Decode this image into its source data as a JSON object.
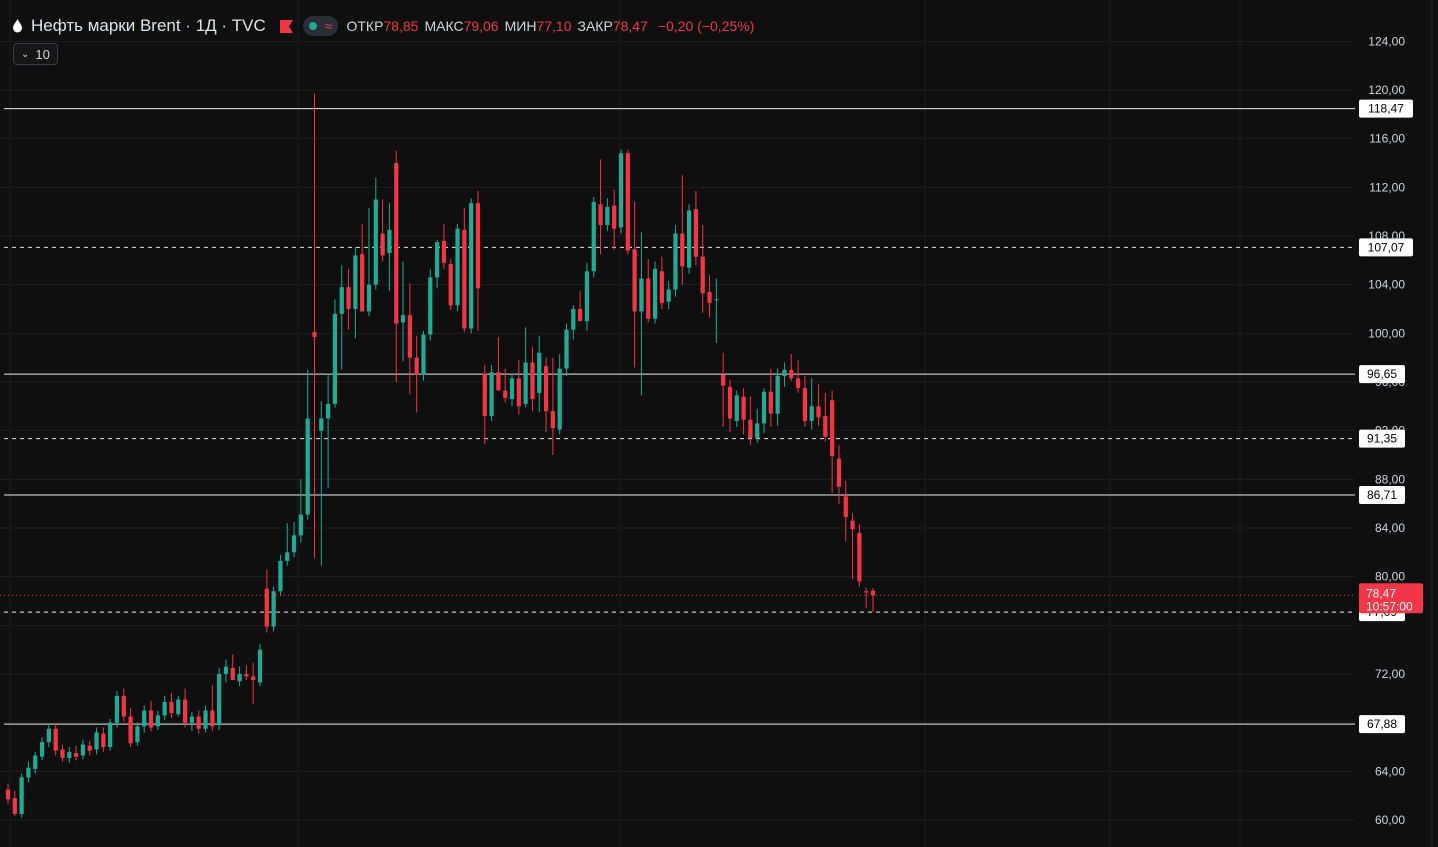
{
  "legend": {
    "title": "Нефть марки Brent · 1Д · TVC",
    "open_label": "ОТКР",
    "open": "78,85",
    "high_label": "МАКС",
    "high": "79,06",
    "low_label": "МИН",
    "low": "77,10",
    "close_label": "ЗАКР",
    "close": "78,47",
    "change": "−0,20 (−0,25%)",
    "collapse_count": "10"
  },
  "colors": {
    "up": "#22ab94",
    "down": "#f23645",
    "background": "#0f0f0f",
    "grid": "#1e1e1e"
  },
  "chart_data": {
    "type": "candlestick",
    "y_axis": {
      "ticks": [
        60,
        64,
        68,
        72,
        76,
        80,
        84,
        88,
        92,
        96,
        100,
        104,
        108,
        112,
        116,
        120,
        124
      ],
      "tick_labels": [
        "60,00",
        "64,00",
        "",
        "72,00",
        "",
        "80,00",
        "84,00",
        "88,00",
        "92,00",
        "96,00",
        "100,00",
        "104,00",
        "108,00",
        "112,00",
        "116,00",
        "120,00",
        "124,00"
      ],
      "ylim": [
        59,
        126
      ],
      "position": "right"
    },
    "current_price": {
      "value": 78.47,
      "label": "78,47",
      "countdown": "10:57:00"
    },
    "levels": [
      {
        "value": 118.47,
        "label": "118,47",
        "style": "solid"
      },
      {
        "value": 107.07,
        "label": "107,07",
        "style": "dashed"
      },
      {
        "value": 96.65,
        "label": "96,65",
        "style": "solid"
      },
      {
        "value": 91.35,
        "label": "91,35",
        "style": "dashed"
      },
      {
        "value": 86.71,
        "label": "86,71",
        "style": "solid"
      },
      {
        "value": 77.09,
        "label": "77,09",
        "style": "dashed"
      },
      {
        "value": 67.88,
        "label": "67,88",
        "style": "solid"
      }
    ],
    "candles": [
      [
        62.5,
        63.0,
        61.3,
        61.7
      ],
      [
        61.8,
        62.4,
        60.3,
        60.5
      ],
      [
        60.5,
        63.8,
        60.2,
        63.5
      ],
      [
        63.5,
        64.8,
        63.1,
        64.3
      ],
      [
        64.2,
        65.6,
        63.8,
        65.3
      ],
      [
        65.2,
        66.8,
        64.9,
        66.4
      ],
      [
        66.4,
        67.9,
        66.0,
        67.5
      ],
      [
        67.5,
        67.9,
        65.3,
        65.7
      ],
      [
        65.8,
        66.2,
        64.8,
        65.1
      ],
      [
        65.1,
        66.0,
        64.7,
        65.6
      ],
      [
        65.5,
        66.1,
        64.9,
        65.2
      ],
      [
        65.3,
        66.6,
        65.0,
        66.2
      ],
      [
        66.1,
        66.5,
        65.3,
        65.7
      ],
      [
        65.8,
        67.6,
        65.4,
        67.2
      ],
      [
        67.1,
        67.6,
        65.6,
        66.0
      ],
      [
        66.0,
        68.3,
        65.7,
        68.0
      ],
      [
        68.0,
        70.6,
        67.6,
        70.2
      ],
      [
        70.2,
        70.8,
        68.1,
        68.5
      ],
      [
        68.5,
        69.2,
        66.0,
        66.3
      ],
      [
        66.4,
        68.0,
        66.1,
        67.7
      ],
      [
        67.7,
        69.4,
        67.2,
        69.0
      ],
      [
        69.0,
        69.8,
        67.3,
        67.6
      ],
      [
        67.7,
        69.0,
        67.4,
        68.6
      ],
      [
        68.6,
        70.2,
        68.2,
        69.7
      ],
      [
        69.7,
        70.4,
        68.4,
        68.8
      ],
      [
        68.7,
        70.2,
        68.5,
        69.9
      ],
      [
        69.9,
        70.8,
        67.6,
        68.0
      ],
      [
        68.0,
        68.9,
        67.3,
        68.5
      ],
      [
        68.5,
        69.0,
        67.1,
        67.5
      ],
      [
        67.5,
        69.4,
        67.2,
        69.0
      ],
      [
        69.0,
        71.1,
        67.3,
        67.7
      ],
      [
        67.8,
        72.5,
        67.4,
        72.0
      ],
      [
        72.0,
        73.2,
        71.3,
        72.6
      ],
      [
        72.5,
        73.6,
        72.0,
        71.5
      ],
      [
        71.4,
        72.6,
        71.0,
        72.0
      ],
      [
        72.0,
        72.7,
        71.5,
        71.8
      ],
      [
        71.8,
        72.9,
        69.5,
        71.5
      ],
      [
        71.3,
        74.5,
        71.0,
        74.0
      ],
      [
        79.0,
        80.6,
        75.4,
        75.9
      ],
      [
        75.9,
        79.2,
        75.5,
        78.8
      ],
      [
        78.8,
        81.8,
        78.4,
        81.3
      ],
      [
        81.3,
        84.4,
        80.9,
        82.0
      ],
      [
        82.0,
        84.5,
        81.6,
        83.4
      ],
      [
        83.4,
        88.0,
        82.8,
        85.1
      ],
      [
        85.1,
        97.0,
        84.7,
        93.0
      ],
      [
        100.1,
        119.7,
        81.5,
        99.7
      ],
      [
        92.0,
        94.4,
        80.9,
        93.0
      ],
      [
        93.0,
        96.7,
        87.3,
        94.2
      ],
      [
        94.2,
        102.8,
        93.9,
        101.6
      ],
      [
        101.6,
        105.6,
        97.0,
        103.8
      ],
      [
        103.8,
        105.3,
        100.3,
        102.0
      ],
      [
        102.0,
        107.1,
        99.6,
        106.4
      ],
      [
        106.5,
        109.0,
        102.8,
        101.8
      ],
      [
        101.8,
        110.3,
        101.4,
        104.0
      ],
      [
        104.0,
        112.8,
        103.6,
        111.0
      ],
      [
        108.2,
        111.0,
        105.9,
        106.4
      ],
      [
        106.6,
        110.7,
        103.5,
        108.5
      ],
      [
        114.0,
        115.0,
        96.0,
        100.8
      ],
      [
        100.9,
        105.9,
        97.7,
        101.5
      ],
      [
        101.5,
        104.1,
        95.0,
        98.0
      ],
      [
        98.0,
        99.8,
        93.5,
        96.6
      ],
      [
        96.6,
        100.2,
        96.1,
        99.9
      ],
      [
        99.9,
        105.3,
        99.4,
        104.6
      ],
      [
        104.6,
        107.7,
        103.7,
        107.5
      ],
      [
        107.6,
        109.0,
        105.3,
        105.8
      ],
      [
        105.7,
        106.1,
        101.9,
        102.3
      ],
      [
        102.3,
        109.0,
        101.8,
        108.6
      ],
      [
        108.5,
        110.3,
        100.1,
        100.4
      ],
      [
        100.4,
        111.1,
        100.0,
        110.7
      ],
      [
        110.7,
        111.7,
        100.2,
        103.7
      ],
      [
        96.7,
        97.4,
        90.9,
        93.2
      ],
      [
        93.2,
        97.4,
        92.8,
        96.8
      ],
      [
        96.8,
        99.7,
        95.8,
        95.3
      ],
      [
        95.3,
        97.1,
        94.3,
        94.7
      ],
      [
        94.6,
        96.7,
        94.0,
        96.3
      ],
      [
        96.3,
        97.8,
        93.3,
        94.0
      ],
      [
        94.2,
        100.5,
        93.9,
        97.6
      ],
      [
        97.6,
        98.9,
        93.6,
        94.6
      ],
      [
        95.1,
        99.8,
        93.5,
        98.4
      ],
      [
        97.3,
        98.0,
        91.9,
        93.6
      ],
      [
        93.6,
        98.0,
        90.0,
        92.2
      ],
      [
        92.1,
        98.3,
        91.7,
        97.1
      ],
      [
        97.1,
        100.8,
        96.5,
        100.3
      ],
      [
        100.3,
        102.3,
        99.5,
        102.0
      ],
      [
        102.0,
        103.5,
        101.0,
        101.0
      ],
      [
        101.0,
        105.8,
        100.2,
        105.1
      ],
      [
        105.1,
        111.2,
        104.6,
        110.8
      ],
      [
        110.6,
        114.3,
        106.5,
        108.9
      ],
      [
        108.9,
        111.1,
        108.4,
        110.4
      ],
      [
        110.5,
        111.8,
        106.9,
        108.6
      ],
      [
        108.7,
        115.1,
        108.2,
        114.8
      ],
      [
        114.8,
        115.1,
        106.5,
        106.8
      ],
      [
        106.9,
        110.8,
        97.2,
        101.8
      ],
      [
        101.8,
        108.3,
        94.9,
        104.5
      ],
      [
        104.5,
        106.1,
        100.9,
        101.2
      ],
      [
        101.2,
        105.9,
        100.8,
        105.3
      ],
      [
        105.1,
        106.3,
        102.0,
        102.5
      ],
      [
        102.6,
        104.3,
        102.0,
        103.6
      ],
      [
        103.6,
        108.9,
        103.0,
        108.2
      ],
      [
        108.2,
        113.0,
        104.0,
        105.5
      ],
      [
        105.4,
        110.6,
        104.9,
        110.1
      ],
      [
        110.2,
        111.7,
        105.6,
        106.3
      ],
      [
        106.3,
        108.9,
        101.7,
        103.3
      ],
      [
        103.4,
        104.8,
        101.3,
        102.5
      ],
      [
        102.8,
        104.5,
        99.2,
        102.8
      ],
      [
        96.6,
        98.4,
        92.3,
        95.7
      ],
      [
        95.6,
        96.2,
        91.9,
        93.0
      ],
      [
        92.8,
        95.3,
        92.3,
        94.9
      ],
      [
        94.8,
        95.5,
        91.7,
        92.9
      ],
      [
        92.9,
        94.8,
        90.8,
        91.4
      ],
      [
        91.4,
        93.8,
        91.0,
        92.6
      ],
      [
        92.6,
        95.5,
        91.8,
        95.2
      ],
      [
        95.2,
        97.1,
        92.3,
        93.4
      ],
      [
        93.4,
        97.1,
        92.4,
        96.5
      ],
      [
        96.5,
        97.6,
        95.6,
        97.0
      ],
      [
        97.0,
        98.3,
        96.1,
        96.3
      ],
      [
        96.3,
        97.8,
        95.1,
        95.5
      ],
      [
        95.5,
        96.5,
        92.3,
        92.8
      ],
      [
        92.8,
        96.3,
        92.1,
        94.0
      ],
      [
        94.0,
        95.8,
        92.4,
        93.1
      ],
      [
        93.2,
        95.1,
        91.1,
        91.5
      ],
      [
        94.5,
        95.3,
        86.9,
        89.9
      ],
      [
        89.7,
        90.8,
        86.0,
        87.4
      ],
      [
        86.6,
        87.9,
        82.9,
        84.9
      ],
      [
        84.6,
        85.2,
        79.8,
        83.9
      ],
      [
        83.6,
        84.3,
        79.2,
        79.6
      ],
      [
        78.8,
        79.1,
        77.4,
        78.7
      ],
      [
        78.85,
        79.06,
        77.1,
        78.47
      ]
    ]
  }
}
